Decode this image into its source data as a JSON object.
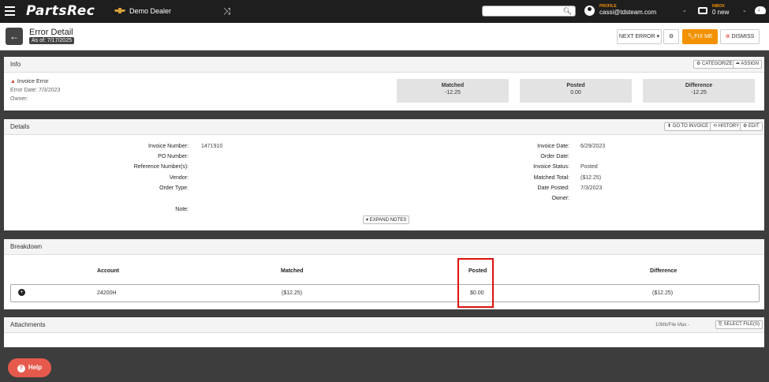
{
  "topbar": {
    "app_name": "PartsRec",
    "dealer": "Demo Dealer",
    "profile_label": "PROFILE",
    "profile_value": "cassi@tdsteam.com",
    "inbox_label": "INBOX",
    "inbox_value": "0 new",
    "icons": [
      "hamburger-icon",
      "chevrolet-logo-icon",
      "shuffle-icon",
      "search-icon",
      "profile-icon",
      "inbox-icon",
      "cloud-download-icon"
    ]
  },
  "header": {
    "title": "Error Detail",
    "as_of": "As of: 7/17/2025",
    "next_error": "NEXT ERROR",
    "fix_me": "FIX ME",
    "dismiss": "DISMISS"
  },
  "info": {
    "title": "Info",
    "categorize": "CATEGORIZE",
    "assign": "ASSIGN",
    "error_type": "Invoice Error",
    "error_date": "Error Date: 7/3/2023",
    "owner": "Owner:",
    "stats": [
      {
        "label": "Matched",
        "value": "-12.25"
      },
      {
        "label": "Posted",
        "value": "0.00"
      },
      {
        "label": "Difference",
        "value": "-12.25"
      }
    ]
  },
  "details": {
    "title": "Details",
    "go_to_invoice": "GO TO INVOICE",
    "history": "HISTORY",
    "edit": "EDIT",
    "left": [
      {
        "label": "Invoice Number:",
        "value": "1471910"
      },
      {
        "label": "PO Number:",
        "value": ""
      },
      {
        "label": "Reference Number(s):",
        "value": ""
      },
      {
        "label": "Vendor:",
        "value": ""
      },
      {
        "label": "Order Type:",
        "value": ""
      }
    ],
    "note_label": "Note:",
    "right": [
      {
        "label": "Invoice Date:",
        "value": "6/29/2023"
      },
      {
        "label": "Order Date:",
        "value": ""
      },
      {
        "label": "Invoice Status:",
        "value": "Posted"
      },
      {
        "label": "Matched Total:",
        "value": "($12.25)"
      },
      {
        "label": "Date Posted:",
        "value": "7/3/2023"
      },
      {
        "label": "Owner:",
        "value": ""
      }
    ],
    "expand_notes": "EXPAND NOTES"
  },
  "breakdown": {
    "title": "Breakdown",
    "columns": [
      "Account",
      "Matched",
      "Posted",
      "Difference"
    ],
    "row": {
      "account": "24200H",
      "matched": "($12.25)",
      "posted": "$0.00",
      "difference": "($12.25)"
    }
  },
  "attachments": {
    "title": "Attachments",
    "file_max": "10Mb/File Max -",
    "select_files": "SELECT FILE(S)"
  },
  "help": {
    "label": "Help"
  },
  "colors": {
    "accent": "#f39200",
    "topbar": "#1e1e1e",
    "highlight": "#dd1111",
    "help": "#e55a4c"
  }
}
